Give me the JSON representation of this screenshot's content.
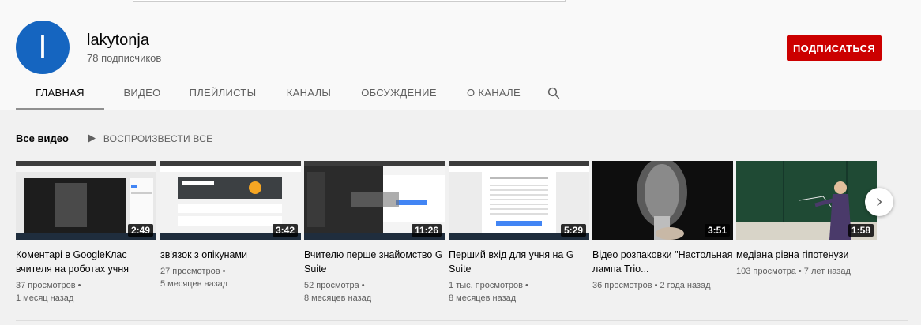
{
  "channel": {
    "avatar_letter": "I",
    "name": "lakytonja",
    "subscribers": "78 подписчиков",
    "subscribe_label": "ПОДПИСАТЬСЯ"
  },
  "tabs": [
    {
      "label": "ГЛАВНАЯ",
      "active": true
    },
    {
      "label": "ВИДЕО"
    },
    {
      "label": "ПЛЕЙЛИСТЫ"
    },
    {
      "label": "КАНАЛЫ"
    },
    {
      "label": "ОБСУЖДЕНИЕ"
    },
    {
      "label": "О КАНАЛЕ"
    }
  ],
  "section": {
    "title": "Все видео",
    "play_all": "ВОСПРОИЗВЕСТИ ВСЕ"
  },
  "videos": [
    {
      "title": "Коментарі в GoogleКлас вчителя на роботах учня",
      "duration": "2:49",
      "views": "37 просмотров •",
      "age": "1 месяц назад"
    },
    {
      "title": "зв'язок з опікунами",
      "duration": "3:42",
      "views": "27 просмотров •",
      "age": "5 месяцев назад"
    },
    {
      "title": "Вчителю перше знайомство G Suite",
      "duration": "11:26",
      "views": "52 просмотра •",
      "age": "8 месяцев назад"
    },
    {
      "title": "Перший вхід для учня на G Suite",
      "duration": "5:29",
      "views": "1 тыс. просмотров •",
      "age": "8 месяцев назад"
    },
    {
      "title": "Відео розпаковки \"Настольная лампа Trio...",
      "duration": "3:51",
      "views": "36 просмотров • 2 года назад",
      "age": ""
    },
    {
      "title": "медіана рівна гіпотенузи",
      "duration": "1:58",
      "views": "103 просмотра • 7 лет назад",
      "age": ""
    }
  ],
  "colors": {
    "brand_red": "#cc0000",
    "avatar_blue": "#1565c0"
  }
}
